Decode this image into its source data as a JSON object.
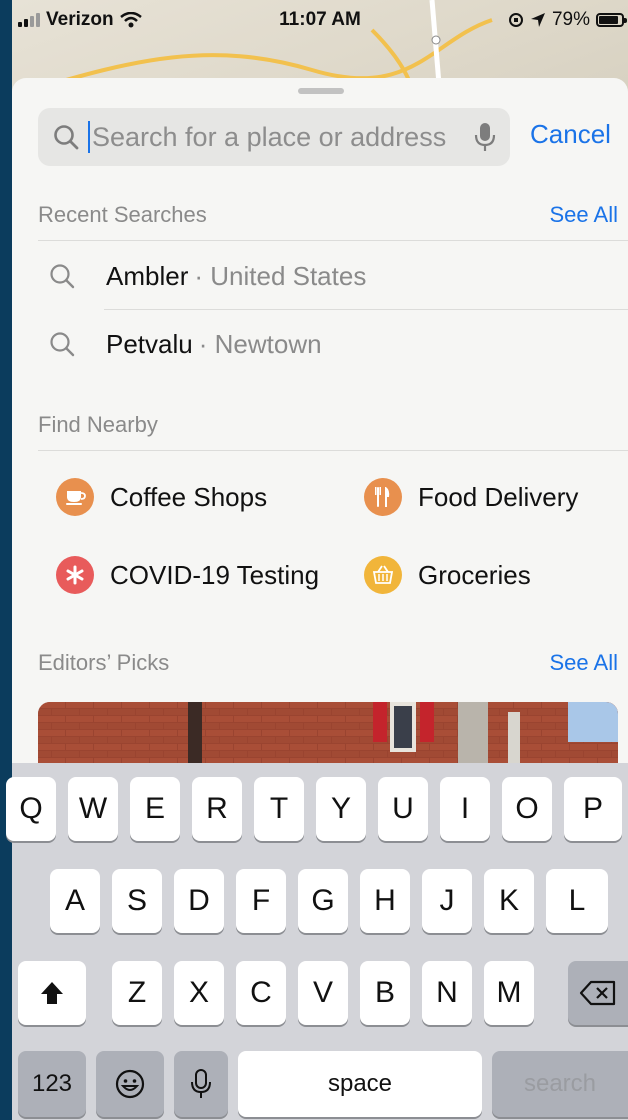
{
  "status_bar": {
    "carrier": "Verizon",
    "time": "11:07 AM",
    "battery": "79%",
    "battery_level": 0.79
  },
  "search": {
    "placeholder": "Search for a place or address",
    "value": "",
    "cancel_label": "Cancel"
  },
  "recent": {
    "header": "Recent Searches",
    "see_all": "See All",
    "items": [
      {
        "title": "Ambler",
        "subtitle": "· United States"
      },
      {
        "title": "Petvalu",
        "subtitle": "· Newtown"
      }
    ]
  },
  "nearby": {
    "header": "Find Nearby",
    "items": [
      {
        "label": "Coffee Shops",
        "icon": "coffee-cup-icon",
        "color": "#e8904e"
      },
      {
        "label": "Food Delivery",
        "icon": "fork-knife-icon",
        "color": "#e8904e"
      },
      {
        "label": "COVID-19 Testing",
        "icon": "asterisk-icon",
        "color": "#e85b5b"
      },
      {
        "label": "Groceries",
        "icon": "basket-icon",
        "color": "#f1b53a"
      }
    ]
  },
  "editors": {
    "header": "Editors’ Picks",
    "see_all": "See All"
  },
  "keyboard": {
    "row1": [
      "Q",
      "W",
      "E",
      "R",
      "T",
      "Y",
      "U",
      "I",
      "O",
      "P"
    ],
    "row2": [
      "A",
      "S",
      "D",
      "F",
      "G",
      "H",
      "J",
      "K",
      "L"
    ],
    "row3": [
      "Z",
      "X",
      "C",
      "V",
      "B",
      "N",
      "M"
    ],
    "numbers_label": "123",
    "space_label": "space",
    "search_label": "search"
  }
}
